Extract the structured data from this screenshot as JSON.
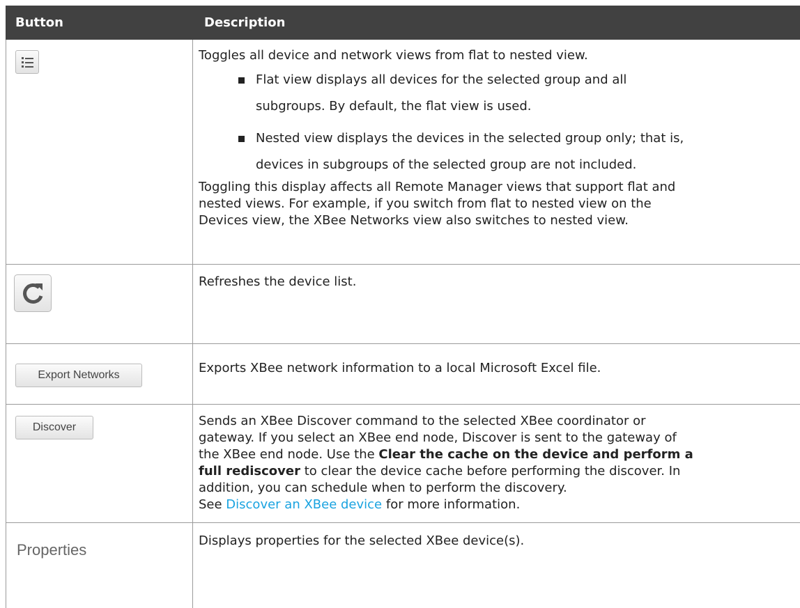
{
  "header": {
    "col_button": "Button",
    "col_description": "Description"
  },
  "rows": [
    {
      "icon": "list-view-icon",
      "desc_intro": "Toggles all device and network views from flat to nested view.",
      "bullet1_l1": "Flat view displays all devices for the selected group and all",
      "bullet1_l2": "subgroups. By default, the flat view is used.",
      "bullet2_l1": "Nested view displays the devices in the selected group only; that is,",
      "bullet2_l2": "devices in subgroups of the selected group are not included.",
      "desc_outro_l1": "Toggling this display affects all Remote Manager views that support flat and",
      "desc_outro_l2": "nested views. For example, if you switch from flat to nested view on the",
      "desc_outro_l3": "Devices view, the XBee Networks view also switches to nested view."
    },
    {
      "icon": "refresh-icon",
      "desc": "Refreshes the device list."
    },
    {
      "button_label": "Export Networks",
      "desc": "Exports XBee network information to a local Microsoft Excel file."
    },
    {
      "button_label": "Discover",
      "desc_l1": "Sends an XBee Discover command to the selected XBee coordinator or",
      "desc_l2": "gateway. If you select an XBee end node, Discover is sent to the gateway of",
      "desc_l3_pre": "the XBee end node. Use the ",
      "desc_l3_bold": "Clear the cache on the device and perform a",
      "desc_l4_bold": "full rediscover",
      "desc_l4_post": " to clear the device cache before performing the discover. In",
      "desc_l5": "addition, you can schedule when to perform the discovery.",
      "desc_l6_pre": "See ",
      "desc_l6_link": "Discover an XBee device",
      "desc_l6_post": " for more information."
    },
    {
      "button_label": "Properties",
      "desc": "Displays properties for the selected XBee device(s)."
    }
  ],
  "colors": {
    "header_bg": "#414141",
    "link": "#1aa3e0",
    "grid": "#9a9a9a"
  }
}
